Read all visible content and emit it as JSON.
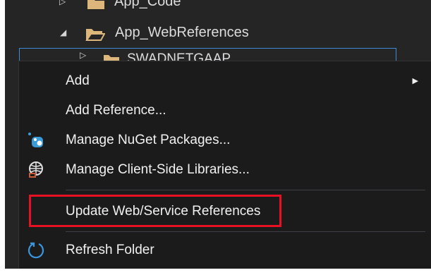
{
  "tree": {
    "row_top_label": "App_Code",
    "row_webrefs_label": "App_WebReferences",
    "row_selected_label": "SWADNETGAAP"
  },
  "context_menu": {
    "items": [
      {
        "label": "Add",
        "icon": "none",
        "has_submenu": true
      },
      {
        "label": "Add Reference...",
        "icon": "none",
        "has_submenu": false
      },
      {
        "label": "Manage NuGet Packages...",
        "icon": "nuget-icon",
        "has_submenu": false
      },
      {
        "label": "Manage Client-Side Libraries...",
        "icon": "client-libraries-icon",
        "has_submenu": false
      },
      {
        "label": "Update Web/Service References",
        "icon": "none",
        "has_submenu": false
      },
      {
        "label": "Refresh Folder",
        "icon": "refresh-icon",
        "has_submenu": false
      }
    ]
  },
  "colors": {
    "menu_background": "#1b1b1c",
    "panel_background": "#252526",
    "text": "#f1f1f1",
    "selection_border": "#3e8ad6",
    "highlight_box": "#e81123",
    "folder": "#dcb67a",
    "nuget_blue": "#3a9bd9",
    "refresh_blue": "#3a96dd"
  }
}
